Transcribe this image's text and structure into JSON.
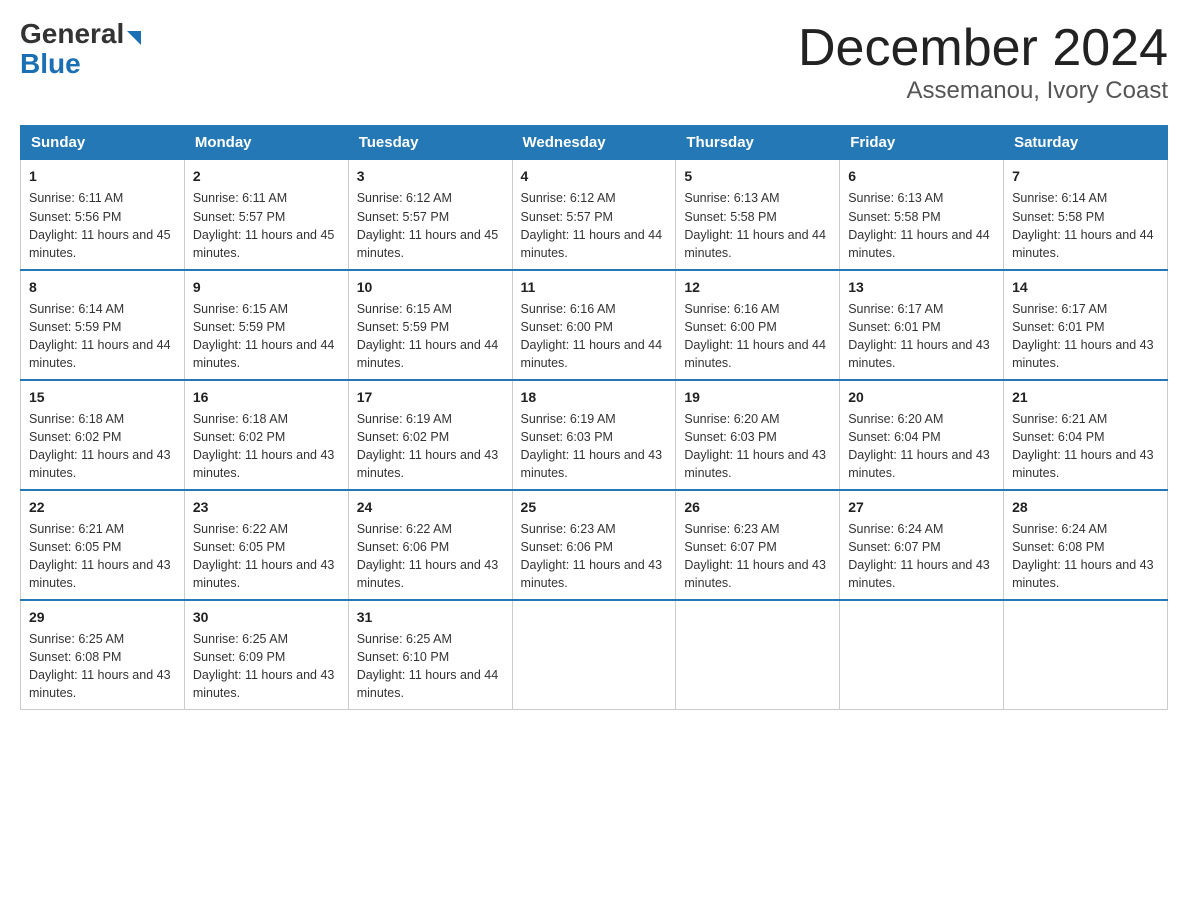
{
  "logo": {
    "general": "General",
    "blue": "Blue"
  },
  "header": {
    "month": "December 2024",
    "location": "Assemanou, Ivory Coast"
  },
  "days_of_week": [
    "Sunday",
    "Monday",
    "Tuesday",
    "Wednesday",
    "Thursday",
    "Friday",
    "Saturday"
  ],
  "weeks": [
    [
      {
        "day": "1",
        "sunrise": "6:11 AM",
        "sunset": "5:56 PM",
        "daylight": "11 hours and 45 minutes."
      },
      {
        "day": "2",
        "sunrise": "6:11 AM",
        "sunset": "5:57 PM",
        "daylight": "11 hours and 45 minutes."
      },
      {
        "day": "3",
        "sunrise": "6:12 AM",
        "sunset": "5:57 PM",
        "daylight": "11 hours and 45 minutes."
      },
      {
        "day": "4",
        "sunrise": "6:12 AM",
        "sunset": "5:57 PM",
        "daylight": "11 hours and 44 minutes."
      },
      {
        "day": "5",
        "sunrise": "6:13 AM",
        "sunset": "5:58 PM",
        "daylight": "11 hours and 44 minutes."
      },
      {
        "day": "6",
        "sunrise": "6:13 AM",
        "sunset": "5:58 PM",
        "daylight": "11 hours and 44 minutes."
      },
      {
        "day": "7",
        "sunrise": "6:14 AM",
        "sunset": "5:58 PM",
        "daylight": "11 hours and 44 minutes."
      }
    ],
    [
      {
        "day": "8",
        "sunrise": "6:14 AM",
        "sunset": "5:59 PM",
        "daylight": "11 hours and 44 minutes."
      },
      {
        "day": "9",
        "sunrise": "6:15 AM",
        "sunset": "5:59 PM",
        "daylight": "11 hours and 44 minutes."
      },
      {
        "day": "10",
        "sunrise": "6:15 AM",
        "sunset": "5:59 PM",
        "daylight": "11 hours and 44 minutes."
      },
      {
        "day": "11",
        "sunrise": "6:16 AM",
        "sunset": "6:00 PM",
        "daylight": "11 hours and 44 minutes."
      },
      {
        "day": "12",
        "sunrise": "6:16 AM",
        "sunset": "6:00 PM",
        "daylight": "11 hours and 44 minutes."
      },
      {
        "day": "13",
        "sunrise": "6:17 AM",
        "sunset": "6:01 PM",
        "daylight": "11 hours and 43 minutes."
      },
      {
        "day": "14",
        "sunrise": "6:17 AM",
        "sunset": "6:01 PM",
        "daylight": "11 hours and 43 minutes."
      }
    ],
    [
      {
        "day": "15",
        "sunrise": "6:18 AM",
        "sunset": "6:02 PM",
        "daylight": "11 hours and 43 minutes."
      },
      {
        "day": "16",
        "sunrise": "6:18 AM",
        "sunset": "6:02 PM",
        "daylight": "11 hours and 43 minutes."
      },
      {
        "day": "17",
        "sunrise": "6:19 AM",
        "sunset": "6:02 PM",
        "daylight": "11 hours and 43 minutes."
      },
      {
        "day": "18",
        "sunrise": "6:19 AM",
        "sunset": "6:03 PM",
        "daylight": "11 hours and 43 minutes."
      },
      {
        "day": "19",
        "sunrise": "6:20 AM",
        "sunset": "6:03 PM",
        "daylight": "11 hours and 43 minutes."
      },
      {
        "day": "20",
        "sunrise": "6:20 AM",
        "sunset": "6:04 PM",
        "daylight": "11 hours and 43 minutes."
      },
      {
        "day": "21",
        "sunrise": "6:21 AM",
        "sunset": "6:04 PM",
        "daylight": "11 hours and 43 minutes."
      }
    ],
    [
      {
        "day": "22",
        "sunrise": "6:21 AM",
        "sunset": "6:05 PM",
        "daylight": "11 hours and 43 minutes."
      },
      {
        "day": "23",
        "sunrise": "6:22 AM",
        "sunset": "6:05 PM",
        "daylight": "11 hours and 43 minutes."
      },
      {
        "day": "24",
        "sunrise": "6:22 AM",
        "sunset": "6:06 PM",
        "daylight": "11 hours and 43 minutes."
      },
      {
        "day": "25",
        "sunrise": "6:23 AM",
        "sunset": "6:06 PM",
        "daylight": "11 hours and 43 minutes."
      },
      {
        "day": "26",
        "sunrise": "6:23 AM",
        "sunset": "6:07 PM",
        "daylight": "11 hours and 43 minutes."
      },
      {
        "day": "27",
        "sunrise": "6:24 AM",
        "sunset": "6:07 PM",
        "daylight": "11 hours and 43 minutes."
      },
      {
        "day": "28",
        "sunrise": "6:24 AM",
        "sunset": "6:08 PM",
        "daylight": "11 hours and 43 minutes."
      }
    ],
    [
      {
        "day": "29",
        "sunrise": "6:25 AM",
        "sunset": "6:08 PM",
        "daylight": "11 hours and 43 minutes."
      },
      {
        "day": "30",
        "sunrise": "6:25 AM",
        "sunset": "6:09 PM",
        "daylight": "11 hours and 43 minutes."
      },
      {
        "day": "31",
        "sunrise": "6:25 AM",
        "sunset": "6:10 PM",
        "daylight": "11 hours and 44 minutes."
      },
      null,
      null,
      null,
      null
    ]
  ],
  "labels": {
    "sunrise": "Sunrise:",
    "sunset": "Sunset:",
    "daylight": "Daylight:"
  }
}
